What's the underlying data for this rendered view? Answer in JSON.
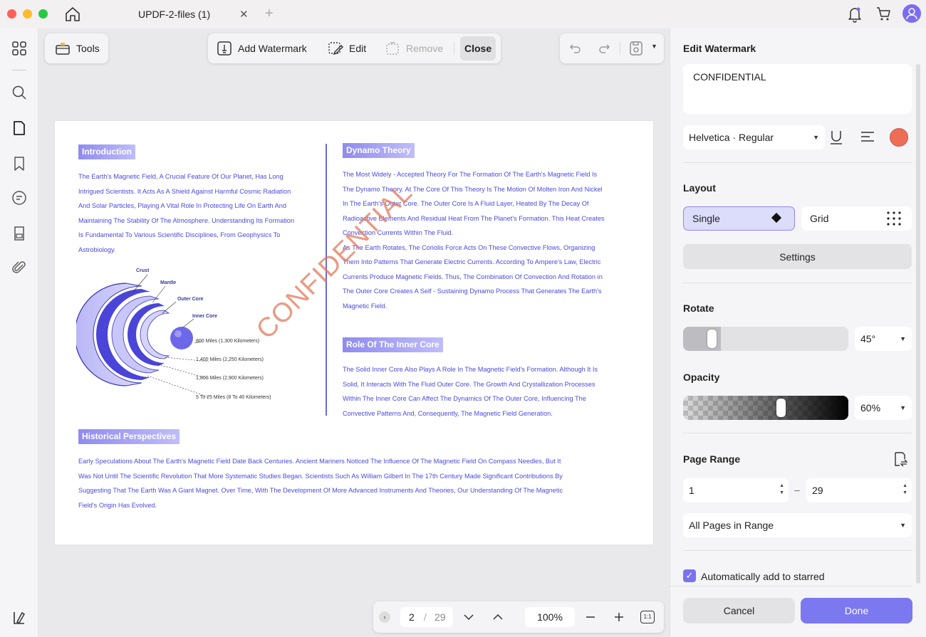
{
  "titlebar": {
    "tab_title": "UPDF-2-files (1)",
    "tab_close": "✕",
    "tab_add": "+"
  },
  "toolbar": {
    "tools_label": "Tools",
    "add_watermark_label": "Add Watermark",
    "edit_label": "Edit",
    "remove_label": "Remove",
    "close_label": "Close"
  },
  "document": {
    "intro_heading": "Introduction",
    "intro_lines": [
      "The Earth's Magnetic Field, A Crucial Feature Of Our Planet, Has Long",
      "Intrigued Scientists. It Acts As A Shield Against Harmful Cosmic Radiation",
      "And Solar Particles, Playing A Vital Role In Protecting Life On Earth And",
      "Maintaining The Stability Of The Atmosphere. Understanding Its Formation",
      "Is Fundamental To Various Scientific Disciplines, From Geophysics To",
      "Astrobiology."
    ],
    "dynamo_heading": "Dynamo Theory",
    "dynamo_lines": [
      "The Most Widely - Accepted Theory For The Formation Of The Earth's Magnetic Field Is",
      "The Dynamo Theory. At The Core Of This Theory Is The Motion Of Molten Iron And Nickel",
      "In The Earth's Outer Core. The Outer Core Is A Fluid Layer, Heated By The Decay Of",
      "Radioactive Elements And Residual Heat From The Planet's Formation. This Heat Creates",
      "Convection Currents Within The Fluid.",
      "As The Earth Rotates, The Coriolis Force Acts On These Convective Flows, Organizing",
      "Them Into Patterns That Generate Electric Currents. According To Ampere's Law, Electric",
      "Currents Produce Magnetic Fields. Thus, The Combination Of Convection And Rotation in",
      "The Outer Core Creates A Self - Sustaining Dynamo Process That Generates The Earth's",
      "Magnetic Field."
    ],
    "inner_heading": "Role Of The Inner Core",
    "inner_lines": [
      "The Solid Inner Core Also Plays A Role In The Magnetic Field's Formation. Although It Is",
      "Solid, It Interacts With The Fluid Outer Core. The Growth And Crystallization Processes",
      "Within The Inner Core Can Affect The Dynamics Of The Outer Core, Influencing The",
      "Convective Patterns And, Consequently, The Magnetic Field Generation."
    ],
    "historical_heading": "Historical Perspectives",
    "historical_lines": [
      "Early Speculations About The Earth's Magnetic Field Date Back Centuries. Ancient Mariners Noticed The Influence Of The Magnetic Field On Compass Needles, But It",
      "Was Not Until The Scientific Revolution That More Systematic Studies Began. Scientists Such As William Gilbert In The 17th Century Made Significant Contributions By",
      "Suggesting That The Earth Was A Giant Magnet. Over Time, With The Development Of More Advanced Instruments And Theories, Our Understanding Of The Magnetic",
      "Field's Origin Has Evolved."
    ],
    "diagram": {
      "crust": "Crust",
      "mantle": "Mantle",
      "outer_core": "Outer Core",
      "inner_core": "Inner Core",
      "d1": "800 Miles (1,300 Kilometers)",
      "d2": "1,400 Miles (2,250 Kilometers)",
      "d3": "1,800 Miles (2,900 Kilometers)",
      "d4": "5 To 25 Miles (8 To 40 Kilometers)"
    },
    "watermark_text": "CONFIDENTIAL"
  },
  "pagenav": {
    "current_page": "2",
    "separator": "/",
    "total_pages": "29",
    "zoom": "100%",
    "fit_label": "1:1"
  },
  "panel": {
    "title": "Edit Watermark",
    "watermark_text": "CONFIDENTIAL",
    "font": "Helvetica · Regular",
    "color": "#ec6e55",
    "layout_label": "Layout",
    "single_label": "Single",
    "grid_label": "Grid",
    "settings_label": "Settings",
    "rotate_label": "Rotate",
    "rotate_value": "45°",
    "rotate_level": 0.02,
    "opacity_label": "Opacity",
    "opacity_value": "60%",
    "opacity_level": 0.6,
    "page_range_label": "Page Range",
    "range_from": "1",
    "range_dash": "–",
    "range_to": "29",
    "range_mode": "All Pages in Range",
    "auto_star_label": "Automatically add to starred",
    "auto_star_checked": true,
    "cancel_label": "Cancel",
    "done_label": "Done",
    "accent": "#7b78f0"
  }
}
